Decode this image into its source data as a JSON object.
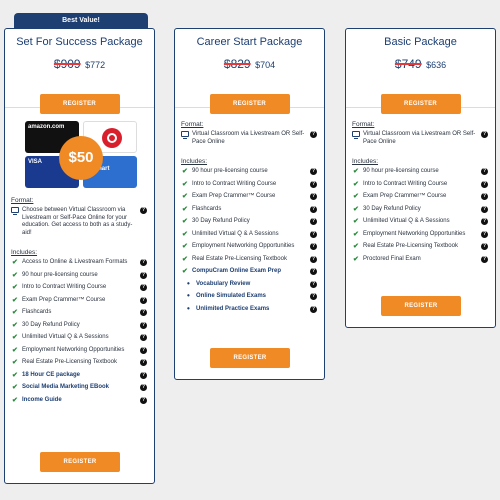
{
  "cards": [
    {
      "ribbon": "Best Value!",
      "title": "Set For Success Package",
      "old_price": "$909",
      "new_price": "$772",
      "register": "REGISTER",
      "gift": {
        "badge": "$50",
        "amazon": "amazon.com",
        "visa": "VISA",
        "walmart": "Walmart"
      },
      "format_label": "Format:",
      "format_text": "Choose between Virtual Classroom via Livestream or Self-Pace Online for your education. Get access to both as a study-aid!",
      "includes_label": "Includes:",
      "features": [
        {
          "text": "Access to Online & Livestream Formats",
          "style": "normal"
        },
        {
          "text": "90 hour pre-licensing course",
          "style": "normal"
        },
        {
          "text": "Intro to Contract Writing Course",
          "style": "normal"
        },
        {
          "text": "Exam Prep Crammer™ Course",
          "style": "normal"
        },
        {
          "text": "Flashcards",
          "style": "normal"
        },
        {
          "text": "30 Day Refund Policy",
          "style": "normal"
        },
        {
          "text": "Unlimited Virtual Q & A Sessions",
          "style": "normal"
        },
        {
          "text": "Employment Networking Opportunities",
          "style": "normal"
        },
        {
          "text": "Real Estate Pre-Licensing Textbook",
          "style": "normal"
        },
        {
          "text": "18 Hour CE package",
          "style": "bold"
        },
        {
          "text": "Social Media Marketing EBook",
          "style": "bold"
        },
        {
          "text": "Income Guide",
          "style": "bold"
        }
      ]
    },
    {
      "title": "Career Start Package",
      "old_price": "$829",
      "new_price": "$704",
      "register": "REGISTER",
      "format_label": "Format:",
      "format_text": "Virtual Classroom via Livestream OR Self-Pace Online",
      "includes_label": "Includes:",
      "features": [
        {
          "text": "90 hour pre-licensing course",
          "style": "normal"
        },
        {
          "text": "Intro to Contract Writing Course",
          "style": "normal"
        },
        {
          "text": "Exam Prep Crammer™ Course",
          "style": "normal"
        },
        {
          "text": "Flashcards",
          "style": "normal"
        },
        {
          "text": "30 Day Refund Policy",
          "style": "normal"
        },
        {
          "text": "Unlimited Virtual Q & A Sessions",
          "style": "normal"
        },
        {
          "text": "Employment Networking Opportunities",
          "style": "normal"
        },
        {
          "text": "Real Estate Pre-Licensing Textbook",
          "style": "normal"
        },
        {
          "text": "CompuCram Online Exam Prep",
          "style": "bold"
        },
        {
          "text": "Vocabulary Review",
          "style": "sub"
        },
        {
          "text": "Online Simulated Exams",
          "style": "sub"
        },
        {
          "text": "Unlimited Practice Exams",
          "style": "sub"
        }
      ]
    },
    {
      "title": "Basic Package",
      "old_price": "$749",
      "new_price": "$636",
      "register": "REGISTER",
      "format_label": "Format:",
      "format_text": "Virtual Classroom via Livestream OR Self-Pace Online",
      "includes_label": "Includes:",
      "features": [
        {
          "text": "90 hour pre-licensing course",
          "style": "normal"
        },
        {
          "text": "Intro to Contract Writing Course",
          "style": "normal"
        },
        {
          "text": "Exam Prep Crammer™ Course",
          "style": "normal"
        },
        {
          "text": "30 Day Refund Policy",
          "style": "normal"
        },
        {
          "text": "Unlimited Virtual Q & A Sessions",
          "style": "normal"
        },
        {
          "text": "Employment Networking Opportunities",
          "style": "normal"
        },
        {
          "text": "Real Estate Pre-Licensing Textbook",
          "style": "normal"
        },
        {
          "text": "Proctored Final Exam",
          "style": "normal"
        }
      ]
    }
  ],
  "colors": {
    "navy": "#1d3f72",
    "orange": "#f08a24",
    "green": "#2b8a3e",
    "strike": "#e23a3a"
  }
}
